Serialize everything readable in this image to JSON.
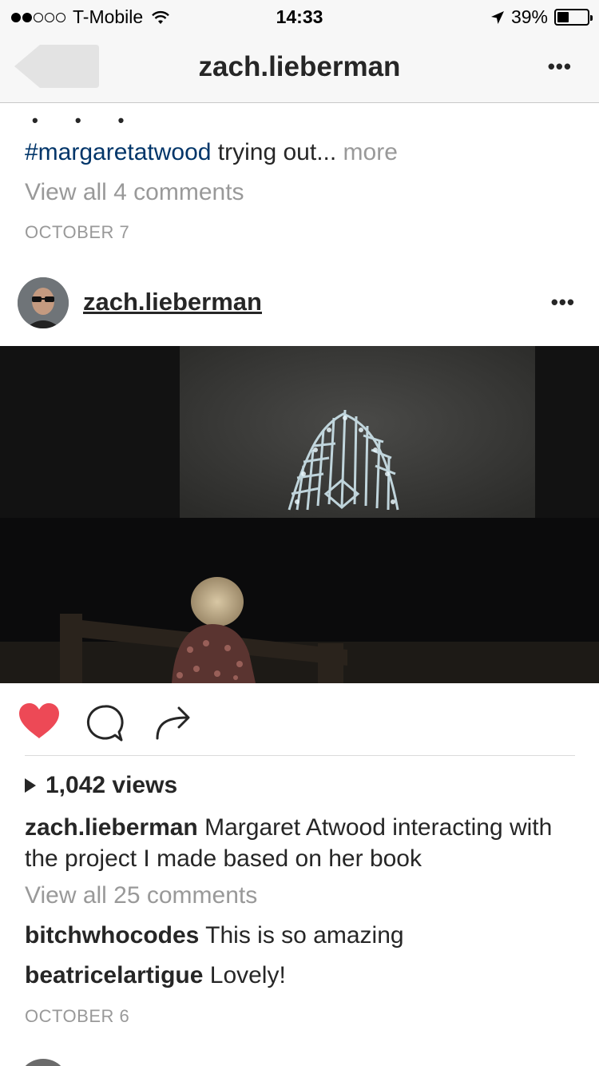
{
  "status_bar": {
    "carrier": "T-Mobile",
    "time": "14:33",
    "battery_percent": "39%",
    "battery_level": 0.39,
    "signal_bars_filled": 2,
    "signal_bars_total": 5
  },
  "nav": {
    "title": "zach.lieberman",
    "more_label": "•••"
  },
  "previous_post": {
    "dots": "• • •",
    "hashtag": "#margaretatwood",
    "caption_text": " trying out...",
    "more_label": " more",
    "view_all_comments": "View all 4 comments",
    "date": "OCTOBER 7"
  },
  "post": {
    "username": "zach.lieberman",
    "more_label": "•••",
    "liked": true,
    "views": "1,042 views",
    "caption_username": "zach.lieberman",
    "caption_text": " Margaret Atwood interacting with the project I made based on her book",
    "view_all_comments": "View all 25 comments",
    "comments": [
      {
        "username": "bitchwhocodes",
        "text": " This is so amazing"
      },
      {
        "username": "beatricelartigue",
        "text": " Lovely!"
      }
    ],
    "date": "OCTOBER 6"
  },
  "colors": {
    "like_red": "#ed4956",
    "hashtag_blue": "#003569",
    "muted_gray": "#999999"
  },
  "icons": {
    "back": "back-arrow-icon",
    "like": "heart-icon",
    "comment": "comment-bubble-icon",
    "share": "share-arrow-icon",
    "play": "play-icon",
    "location": "location-arrow-icon",
    "wifi": "wifi-icon"
  }
}
